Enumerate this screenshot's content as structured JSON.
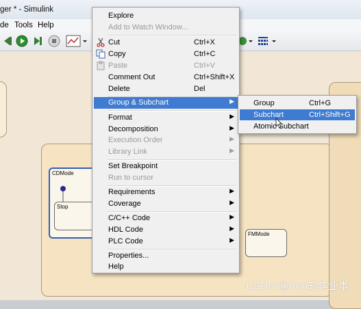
{
  "window": {
    "title": "ger * - Simulink"
  },
  "menubar": {
    "items": [
      {
        "label": "de"
      },
      {
        "label": "Tools"
      },
      {
        "label": "Help"
      }
    ]
  },
  "toolbar": {
    "buttons": [
      "back-icon",
      "run-icon",
      "step-forward-icon",
      "stop-icon",
      "scope-icon",
      "dropdown-icon",
      "library-icon",
      "settings-icon"
    ]
  },
  "canvas": {
    "states": [
      {
        "label": "CDMode"
      },
      {
        "label": "Stop"
      },
      {
        "label": "FMMode"
      }
    ]
  },
  "context_menu": {
    "items": [
      {
        "label": "Explore",
        "shortcut": "",
        "enabled": true
      },
      {
        "label": "Add to Watch Window...",
        "shortcut": "",
        "enabled": false
      },
      {
        "label": "Cut",
        "shortcut": "Ctrl+X",
        "enabled": true,
        "icon": "scissors-icon"
      },
      {
        "label": "Copy",
        "shortcut": "Ctrl+C",
        "enabled": true,
        "icon": "copy-icon"
      },
      {
        "label": "Paste",
        "shortcut": "Ctrl+V",
        "enabled": false,
        "icon": "paste-icon"
      },
      {
        "label": "Comment Out",
        "shortcut": "Ctrl+Shift+X",
        "enabled": true
      },
      {
        "label": "Delete",
        "shortcut": "Del",
        "enabled": true
      },
      {
        "label": "Group & Subchart",
        "shortcut": "",
        "enabled": true,
        "submenu": true,
        "highlighted": true
      },
      {
        "label": "Format",
        "shortcut": "",
        "enabled": true,
        "submenu": true
      },
      {
        "label": "Decomposition",
        "shortcut": "",
        "enabled": true,
        "submenu": true
      },
      {
        "label": "Execution Order",
        "shortcut": "",
        "enabled": false,
        "submenu": true
      },
      {
        "label": "Library Link",
        "shortcut": "",
        "enabled": false,
        "submenu": true
      },
      {
        "label": "Set Breakpoint",
        "shortcut": "",
        "enabled": true
      },
      {
        "label": "Run to cursor",
        "shortcut": "",
        "enabled": false
      },
      {
        "label": "Requirements",
        "shortcut": "",
        "enabled": true,
        "submenu": true
      },
      {
        "label": "Coverage",
        "shortcut": "",
        "enabled": true,
        "submenu": true
      },
      {
        "label": "C/C++ Code",
        "shortcut": "",
        "enabled": true,
        "submenu": true
      },
      {
        "label": "HDL Code",
        "shortcut": "",
        "enabled": true,
        "submenu": true
      },
      {
        "label": "PLC Code",
        "shortcut": "",
        "enabled": true,
        "submenu": true
      },
      {
        "label": "Properties...",
        "shortcut": "",
        "enabled": true
      },
      {
        "label": "Help",
        "shortcut": "",
        "enabled": true
      }
    ]
  },
  "submenu": {
    "items": [
      {
        "label": "Group",
        "shortcut": "Ctrl+G"
      },
      {
        "label": "Subchart",
        "shortcut": "Ctrl+Shift+G",
        "highlighted": true
      },
      {
        "label": "Atomic Subchart",
        "shortcut": ""
      }
    ]
  },
  "watermark": "CSDN @Ron的作业本",
  "colors": {
    "menu_highlight": "#3f7bd0",
    "menu_background": "#f0f0f0",
    "canvas_background": "#f2e7d6",
    "state_selected_border": "#2f5fb3"
  }
}
